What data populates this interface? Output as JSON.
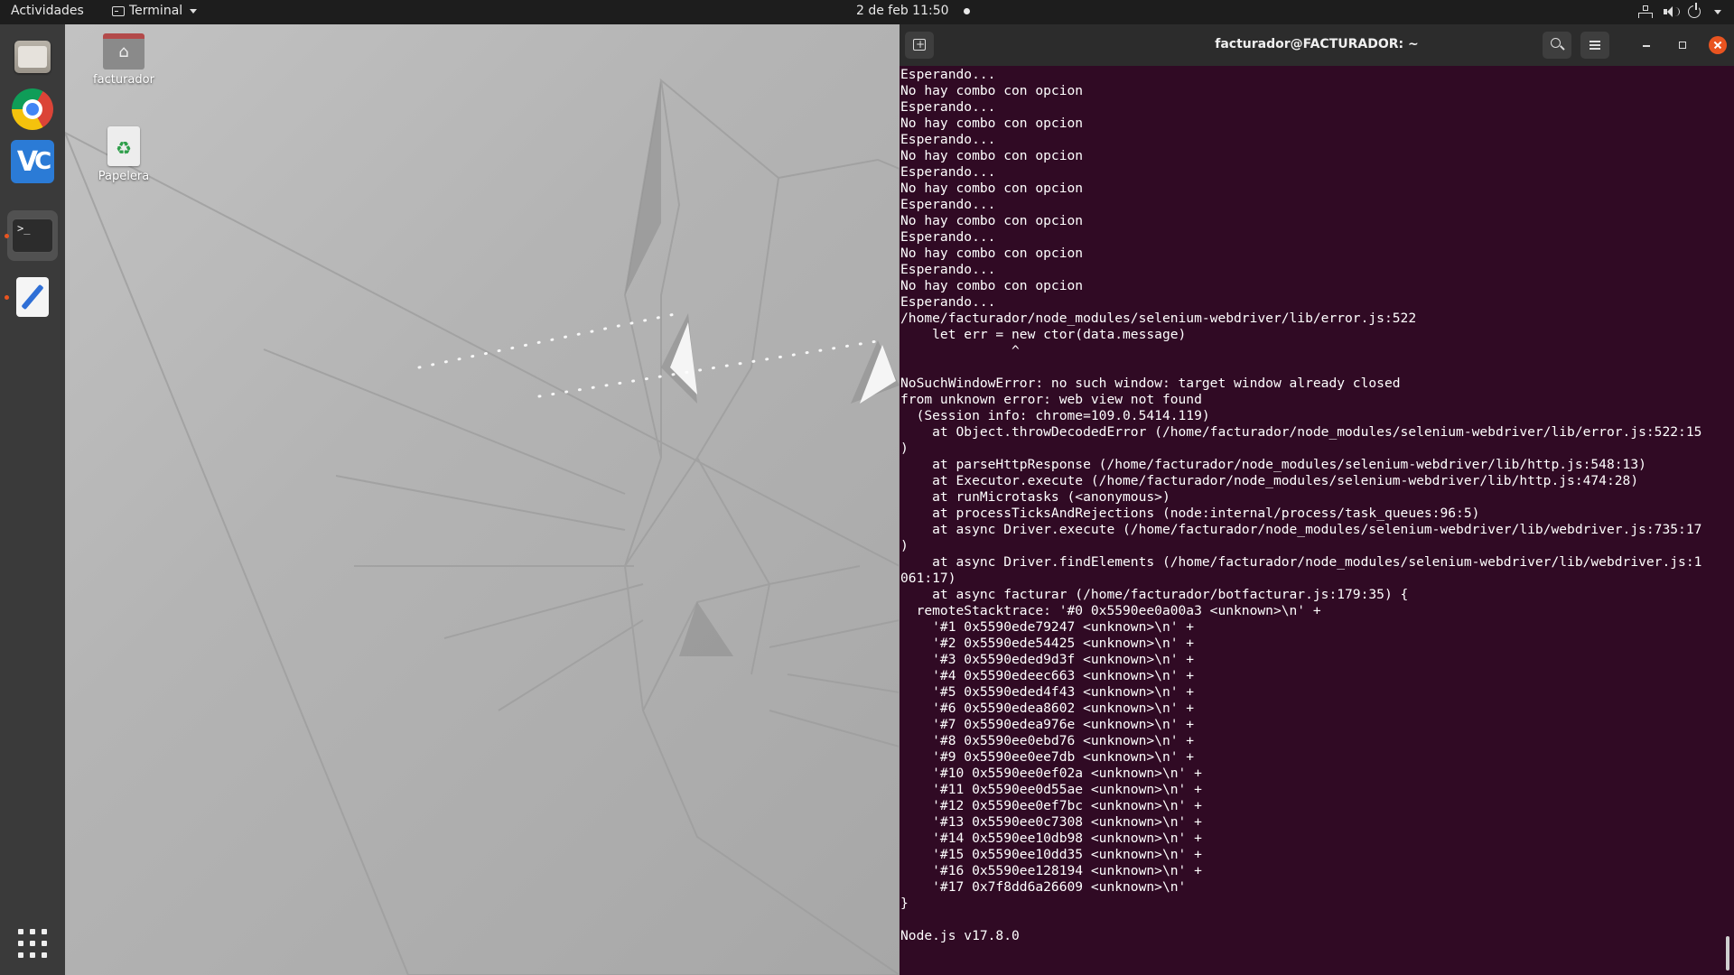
{
  "topbar": {
    "activities": "Actividades",
    "app_menu": "Terminal",
    "clock": "2 de feb  11:50"
  },
  "dock": {
    "items": [
      "files",
      "google-chrome",
      "visual-studio-code",
      "terminal",
      "text-editor"
    ],
    "terminal_glyph": ">_"
  },
  "desktop": {
    "icons": [
      {
        "label": "facturador"
      },
      {
        "label": "Papelera"
      }
    ]
  },
  "terminal": {
    "title": "facturador@FACTURADOR: ~",
    "lines": [
      "Esperando...",
      "No hay combo con opcion",
      "Esperando...",
      "No hay combo con opcion",
      "Esperando...",
      "No hay combo con opcion",
      "Esperando...",
      "No hay combo con opcion",
      "Esperando...",
      "No hay combo con opcion",
      "Esperando...",
      "No hay combo con opcion",
      "Esperando...",
      "No hay combo con opcion",
      "Esperando...",
      "/home/facturador/node_modules/selenium-webdriver/lib/error.js:522",
      "    let err = new ctor(data.message)",
      "              ^",
      "",
      "NoSuchWindowError: no such window: target window already closed",
      "from unknown error: web view not found",
      "  (Session info: chrome=109.0.5414.119)",
      "    at Object.throwDecodedError (/home/facturador/node_modules/selenium-webdriver/lib/error.js:522:15",
      ")",
      "    at parseHttpResponse (/home/facturador/node_modules/selenium-webdriver/lib/http.js:548:13)",
      "    at Executor.execute (/home/facturador/node_modules/selenium-webdriver/lib/http.js:474:28)",
      "    at runMicrotasks (<anonymous>)",
      "    at processTicksAndRejections (node:internal/process/task_queues:96:5)",
      "    at async Driver.execute (/home/facturador/node_modules/selenium-webdriver/lib/webdriver.js:735:17",
      ")",
      "    at async Driver.findElements (/home/facturador/node_modules/selenium-webdriver/lib/webdriver.js:1",
      "061:17)",
      "    at async facturar (/home/facturador/botfacturar.js:179:35) {",
      "  remoteStacktrace: '#0 0x5590ee0a00a3 <unknown>\\n' +",
      "    '#1 0x5590ede79247 <unknown>\\n' +",
      "    '#2 0x5590ede54425 <unknown>\\n' +",
      "    '#3 0x5590eded9d3f <unknown>\\n' +",
      "    '#4 0x5590edeec663 <unknown>\\n' +",
      "    '#5 0x5590eded4f43 <unknown>\\n' +",
      "    '#6 0x5590edea8602 <unknown>\\n' +",
      "    '#7 0x5590edea976e <unknown>\\n' +",
      "    '#8 0x5590ee0ebd76 <unknown>\\n' +",
      "    '#9 0x5590ee0ee7db <unknown>\\n' +",
      "    '#10 0x5590ee0ef02a <unknown>\\n' +",
      "    '#11 0x5590ee0d55ae <unknown>\\n' +",
      "    '#12 0x5590ee0ef7bc <unknown>\\n' +",
      "    '#13 0x5590ee0c7308 <unknown>\\n' +",
      "    '#14 0x5590ee10db98 <unknown>\\n' +",
      "    '#15 0x5590ee10dd35 <unknown>\\n' +",
      "    '#16 0x5590ee128194 <unknown>\\n' +",
      "    '#17 0x7f8dd6a26609 <unknown>\\n'",
      "}",
      "",
      "Node.js v17.8.0"
    ]
  },
  "colors": {
    "terminal_bg": "#300a24",
    "accent": "#e95420",
    "topbar_bg": "#1d1d1d",
    "dock_bg": "#3a3a3a"
  }
}
